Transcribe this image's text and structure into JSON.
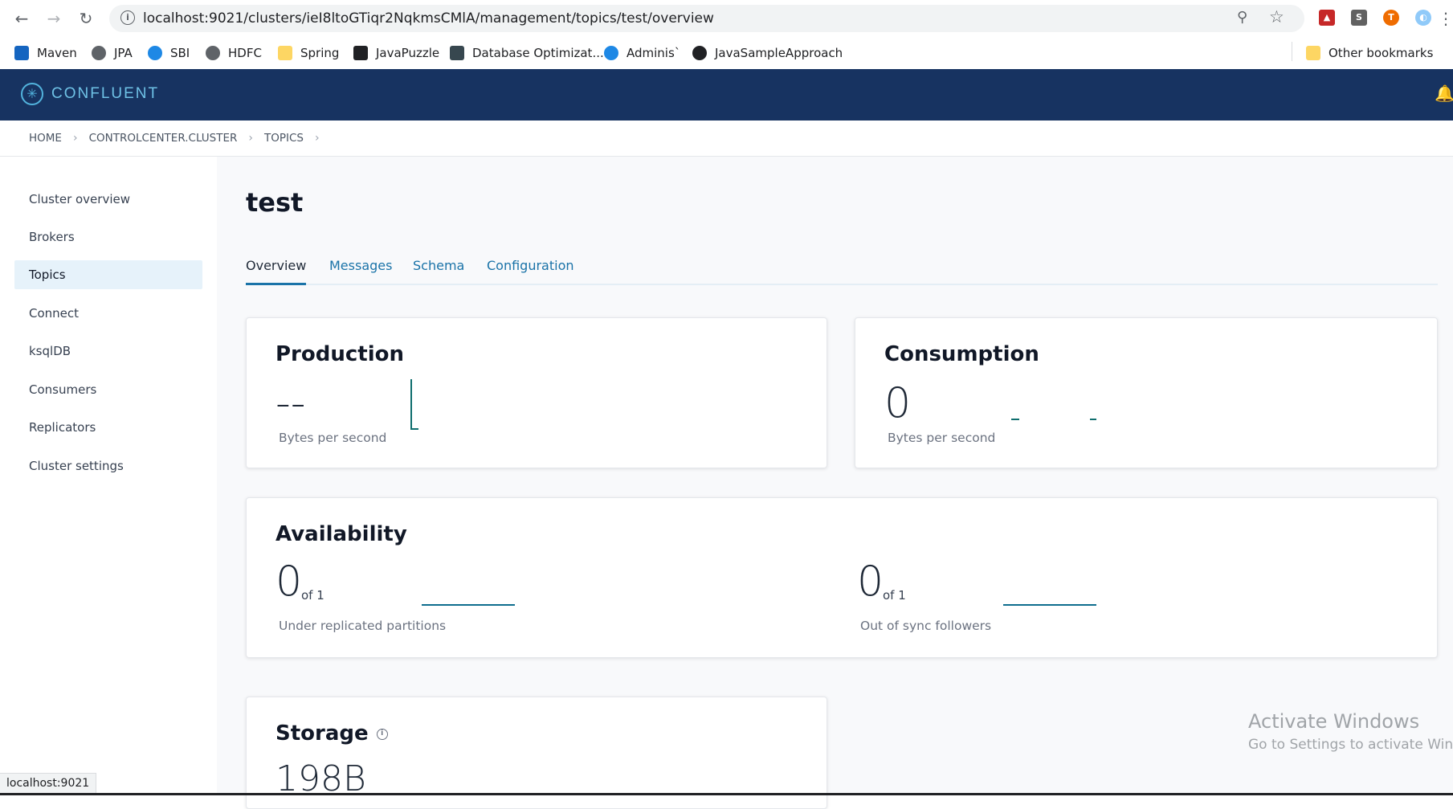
{
  "browser": {
    "url": "localhost:9021/clusters/ieI8ltoGTiqr2NqkmsCMlA/management/topics/test/overview",
    "bookmarks": [
      {
        "label": "Maven",
        "color": "#1565c0"
      },
      {
        "label": "JPA",
        "color": "#5f6368"
      },
      {
        "label": "SBI",
        "color": "#1e88e5"
      },
      {
        "label": "HDFC",
        "color": "#5f6368"
      },
      {
        "label": "Spring",
        "color": "#fdd663"
      },
      {
        "label": "JavaPuzzle",
        "color": "#202124"
      },
      {
        "label": "Database Optimizat...",
        "color": "#37474f"
      },
      {
        "label": "Adminis`",
        "color": "#1e88e5"
      },
      {
        "label": "JavaSampleApproach",
        "color": "#202124"
      }
    ],
    "other_bookmarks": "Other bookmarks",
    "status_url": "localhost:9021"
  },
  "header": {
    "logo": "CONFLUENT",
    "bg_color": "#173361",
    "accent_color": "#52b3dd"
  },
  "breadcrumb": [
    "HOME",
    "CONTROLCENTER.CLUSTER",
    "TOPICS"
  ],
  "sidebar": {
    "items": [
      {
        "label": "Cluster overview",
        "active": false
      },
      {
        "label": "Brokers",
        "active": false
      },
      {
        "label": "Topics",
        "active": true
      },
      {
        "label": "Connect",
        "active": false
      },
      {
        "label": "ksqlDB",
        "active": false
      },
      {
        "label": "Consumers",
        "active": false
      },
      {
        "label": "Replicators",
        "active": false
      },
      {
        "label": "Cluster settings",
        "active": false
      }
    ]
  },
  "main": {
    "title": "test",
    "tabs": [
      {
        "label": "Overview",
        "active": true
      },
      {
        "label": "Messages",
        "active": false
      },
      {
        "label": "Schema",
        "active": false
      },
      {
        "label": "Configuration",
        "active": false
      }
    ],
    "production": {
      "title": "Production",
      "value": "--",
      "label": "Bytes per second"
    },
    "consumption": {
      "title": "Consumption",
      "value": "0",
      "label": "Bytes per second"
    },
    "availability": {
      "title": "Availability",
      "under_replicated": {
        "value": "0",
        "of": "of 1",
        "label": "Under replicated partitions"
      },
      "out_of_sync": {
        "value": "0",
        "of": "of 1",
        "label": "Out of sync followers"
      }
    },
    "storage": {
      "title": "Storage",
      "value": "198B"
    }
  },
  "watermark": {
    "title": "Activate Windows",
    "subtitle": "Go to Settings to activate Windows."
  }
}
